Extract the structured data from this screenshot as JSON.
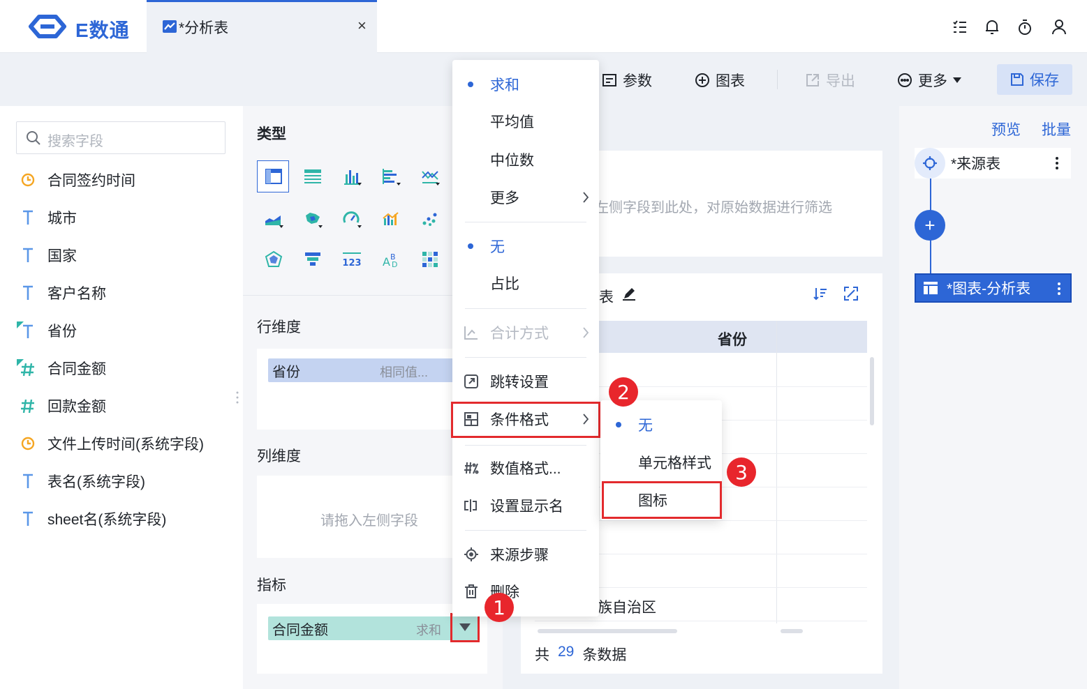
{
  "app": {
    "brand": "E数通"
  },
  "tab": {
    "title": "*分析表",
    "close": "×"
  },
  "toolbar": {
    "params": "参数",
    "chart": "图表",
    "export": "导出",
    "more": "更多",
    "save": "保存"
  },
  "fields": {
    "search_placeholder": "搜索字段",
    "items": [
      {
        "label": "合同签约时间",
        "type": "date"
      },
      {
        "label": "城市",
        "type": "text"
      },
      {
        "label": "国家",
        "type": "text"
      },
      {
        "label": "客户名称",
        "type": "text"
      },
      {
        "label": "省份",
        "type": "geo-text"
      },
      {
        "label": "合同金额",
        "type": "geo-number"
      },
      {
        "label": "回款金额",
        "type": "number"
      },
      {
        "label": "文件上传时间(系统字段)",
        "type": "date"
      },
      {
        "label": "表名(系统字段)",
        "type": "text"
      },
      {
        "label": "sheet名(系统字段)",
        "type": "text"
      }
    ]
  },
  "config": {
    "type_title": "类型",
    "row_dim_title": "行维度",
    "row_pill": {
      "label": "省份",
      "sub": "相同值..."
    },
    "col_dim_title": "列维度",
    "col_placeholder": "请拖入左侧字段",
    "measure_title": "指标",
    "measure_pill": {
      "label": "合同金额",
      "sub": "求和"
    }
  },
  "preview": {
    "filter_hint": "左侧字段到此处，对原始数据进行筛选",
    "table_title": "表",
    "column_header": "省份",
    "last_row_text": "族自治区",
    "footer": {
      "prefix": "共",
      "count": "29",
      "suffix": "条数据"
    }
  },
  "dropdown_menu": {
    "items": [
      {
        "label": "求和",
        "selected": true
      },
      {
        "label": "平均值"
      },
      {
        "label": "中位数"
      },
      {
        "label": "更多",
        "submenu": true
      },
      {
        "label": "无",
        "selected": true
      },
      {
        "label": "占比"
      },
      {
        "label": "合计方式",
        "disabled": true,
        "submenu": true
      },
      {
        "label": "跳转设置"
      },
      {
        "label": "条件格式",
        "submenu": true
      },
      {
        "label": "数值格式..."
      },
      {
        "label": "设置显示名"
      },
      {
        "label": "来源步骤"
      },
      {
        "label": "删除"
      }
    ]
  },
  "sub_menu": {
    "items": [
      {
        "label": "无",
        "selected": true
      },
      {
        "label": "单元格样式"
      },
      {
        "label": "图标"
      }
    ]
  },
  "badges": [
    "1",
    "2",
    "3"
  ],
  "flow": {
    "preview_link": "预览",
    "batch_link": "批量",
    "source_node": "*来源表",
    "chart_node": "*图表-分析表",
    "add": "+"
  },
  "colors": {
    "accent": "#2d66d6",
    "annotation_red": "#e32a2d"
  }
}
